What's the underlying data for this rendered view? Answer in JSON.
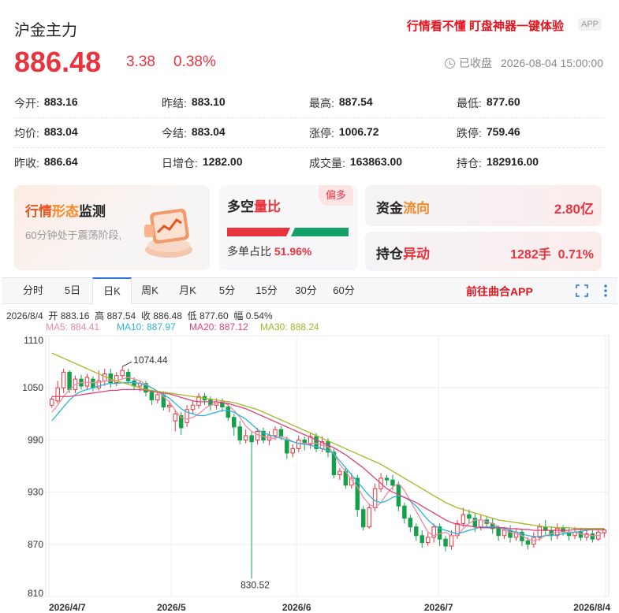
{
  "header": {
    "title": "沪金主力",
    "promo": "行情看不懂 盯盘神器一键体验",
    "app_tag": "APP",
    "price": "886.48",
    "change": "3.38",
    "change_pct": "0.38%",
    "status": "已收盘",
    "datetime": "2026-08-04 15:00:00"
  },
  "stats": [
    [
      {
        "label": "今开:",
        "value": "883.16",
        "color": "red"
      },
      {
        "label": "昨结:",
        "value": "883.10",
        "color": ""
      },
      {
        "label": "最高:",
        "value": "887.54",
        "color": "red"
      },
      {
        "label": "最低:",
        "value": "877.60",
        "color": "green"
      }
    ],
    [
      {
        "label": "均价:",
        "value": "883.04",
        "color": ""
      },
      {
        "label": "今结:",
        "value": "883.04",
        "color": ""
      },
      {
        "label": "涨停:",
        "value": "1006.72",
        "color": ""
      },
      {
        "label": "跌停:",
        "value": "759.46",
        "color": ""
      }
    ],
    [
      {
        "label": "昨收:",
        "value": "886.64",
        "color": ""
      },
      {
        "label": "日增仓:",
        "value": "1282.00",
        "color": ""
      },
      {
        "label": "成交量:",
        "value": "163863.00",
        "color": ""
      },
      {
        "label": "持仓:",
        "value": "182916.00",
        "color": ""
      }
    ]
  ],
  "cards": {
    "monitor_title_a": "行情",
    "monitor_title_b": "形态",
    "monitor_title_c": "监测",
    "monitor_desc": "60分钟处于震荡阶段,",
    "longshort_title_a": "多空",
    "longshort_title_b": "量比",
    "longshort_badge": "偏多",
    "longshort_ratio_label": "多单占比",
    "longshort_ratio": "51.96%",
    "longshort_fraction": 0.5196,
    "flow_title_a": "资金",
    "flow_title_b": "流向",
    "flow_value": "2.80亿",
    "position_title_a": "持仓",
    "position_title_b": "异动",
    "position_value": "1282手",
    "position_pct": "0.71%"
  },
  "tabs": [
    "分时",
    "5日",
    "日K",
    "周K",
    "月K",
    "5分",
    "15分",
    "30分",
    "60分"
  ],
  "active_tab": "日K",
  "open_app": "前往曲合APP",
  "chart_info": {
    "date": "2026/8/4",
    "open_label": "开",
    "open": "883.16",
    "high_label": "高",
    "high": "887.54",
    "close_label": "收",
    "close": "886.48",
    "low_label": "低",
    "low": "877.60",
    "amp_label": "幅",
    "amp": "0.54%"
  },
  "ma": [
    {
      "label": "MA5:",
      "value": "884.41",
      "color": "#f08aa6"
    },
    {
      "label": "MA10:",
      "value": "887.97",
      "color": "#29b5d6"
    },
    {
      "label": "MA20:",
      "value": "887.12",
      "color": "#e0407a"
    },
    {
      "label": "MA30:",
      "value": "888.24",
      "color": "#a3b82a"
    }
  ],
  "chart_data": {
    "type": "candlestick",
    "ylim": [
      810,
      1110
    ],
    "y_ticks": [
      "1110",
      "1050",
      "990",
      "930",
      "870",
      "810"
    ],
    "x_ticks": [
      "2026/4/7",
      "2026/5",
      "2026/6",
      "2026/7",
      "2026/8/4"
    ],
    "annotations": {
      "high": "1074.44",
      "low": "830.52"
    },
    "candles": [
      [
        1030,
        1037,
        1027,
        1040
      ],
      [
        1035,
        1050,
        1032,
        1058
      ],
      [
        1050,
        1068,
        1044,
        1072
      ],
      [
        1068,
        1048,
        1044,
        1070
      ],
      [
        1048,
        1060,
        1044,
        1064
      ],
      [
        1060,
        1052,
        1048,
        1065
      ],
      [
        1052,
        1062,
        1048,
        1066
      ],
      [
        1060,
        1050,
        1046,
        1063
      ],
      [
        1050,
        1058,
        1047,
        1070
      ],
      [
        1058,
        1066,
        1052,
        1072
      ],
      [
        1066,
        1056,
        1050,
        1072
      ],
      [
        1056,
        1064,
        1052,
        1068
      ],
      [
        1064,
        1070,
        1060,
        1074.44
      ],
      [
        1068,
        1058,
        1054,
        1072
      ],
      [
        1058,
        1052,
        1048,
        1062
      ],
      [
        1052,
        1055,
        1046,
        1058
      ],
      [
        1055,
        1045,
        1040,
        1058
      ],
      [
        1045,
        1036,
        1030,
        1048
      ],
      [
        1036,
        1042,
        1032,
        1045
      ],
      [
        1042,
        1028,
        1024,
        1046
      ],
      [
        1028,
        1030,
        1022,
        1035
      ],
      [
        1012,
        1020,
        1000,
        1025
      ],
      [
        1018,
        1004,
        996,
        1022
      ],
      [
        1010,
        1025,
        1005,
        1030
      ],
      [
        1025,
        1030,
        1020,
        1035
      ],
      [
        1030,
        1040,
        1026,
        1044
      ],
      [
        1040,
        1036,
        1030,
        1044
      ],
      [
        1036,
        1030,
        1024,
        1040
      ],
      [
        1030,
        1034,
        1025,
        1038
      ],
      [
        1034,
        1028,
        1022,
        1038
      ],
      [
        1028,
        1016,
        1012,
        1032
      ],
      [
        1016,
        1005,
        995,
        1020
      ],
      [
        1005,
        990,
        985,
        1012
      ],
      [
        990,
        995,
        986,
        1002
      ],
      [
        995,
        988,
        830.52,
        1000
      ],
      [
        990,
        1000,
        985,
        1004
      ],
      [
        1000,
        990,
        986,
        1004
      ],
      [
        990,
        995,
        984,
        1000
      ],
      [
        995,
        1002,
        990,
        1006
      ],
      [
        1002,
        994,
        990,
        1006
      ],
      [
        990,
        975,
        968,
        994
      ],
      [
        975,
        980,
        970,
        985
      ],
      [
        980,
        990,
        976,
        995
      ],
      [
        990,
        985,
        978,
        994
      ],
      [
        985,
        994,
        980,
        998
      ],
      [
        994,
        980,
        976,
        998
      ],
      [
        980,
        988,
        976,
        994
      ],
      [
        988,
        976,
        970,
        992
      ],
      [
        976,
        950,
        946,
        980
      ],
      [
        950,
        954,
        944,
        958
      ],
      [
        954,
        938,
        934,
        958
      ],
      [
        938,
        946,
        934,
        952
      ],
      [
        946,
        910,
        902,
        950
      ],
      [
        910,
        890,
        886,
        914
      ],
      [
        890,
        912,
        888,
        916
      ],
      [
        912,
        934,
        908,
        940
      ],
      [
        934,
        946,
        930,
        952
      ],
      [
        946,
        944,
        938,
        950
      ],
      [
        944,
        938,
        932,
        950
      ],
      [
        938,
        914,
        908,
        942
      ],
      [
        914,
        900,
        894,
        918
      ],
      [
        900,
        890,
        884,
        904
      ],
      [
        890,
        880,
        874,
        894
      ],
      [
        880,
        872,
        866,
        886
      ],
      [
        872,
        878,
        868,
        884
      ],
      [
        878,
        890,
        872,
        894
      ],
      [
        890,
        876,
        868,
        894
      ],
      [
        876,
        868,
        862,
        880
      ],
      [
        868,
        880,
        864,
        886
      ],
      [
        880,
        894,
        876,
        898
      ],
      [
        894,
        904,
        890,
        912
      ],
      [
        904,
        900,
        894,
        910
      ],
      [
        900,
        890,
        884,
        906
      ],
      [
        890,
        898,
        886,
        904
      ],
      [
        898,
        894,
        890,
        902
      ],
      [
        894,
        888,
        882,
        900
      ],
      [
        888,
        880,
        874,
        892
      ],
      [
        880,
        886,
        876,
        890
      ],
      [
        886,
        878,
        872,
        892
      ],
      [
        878,
        884,
        874,
        888
      ],
      [
        884,
        874,
        868,
        888
      ],
      [
        874,
        870,
        864,
        878
      ],
      [
        870,
        878,
        866,
        884
      ],
      [
        878,
        890,
        874,
        894
      ],
      [
        890,
        886,
        880,
        898
      ],
      [
        886,
        880,
        874,
        890
      ],
      [
        880,
        888,
        876,
        894
      ],
      [
        888,
        884,
        880,
        892
      ],
      [
        884,
        880,
        874,
        888
      ],
      [
        880,
        884,
        876,
        890
      ],
      [
        884,
        878,
        874,
        888
      ],
      [
        878,
        882,
        874,
        886
      ],
      [
        882,
        876,
        872,
        888
      ],
      [
        876,
        884,
        874,
        888
      ],
      [
        883.16,
        886.48,
        877.6,
        887.54
      ]
    ],
    "ma_series": {
      "MA5": [
        1022,
        1030,
        1040,
        1048,
        1054,
        1056,
        1056,
        1056,
        1056,
        1058,
        1058,
        1058,
        1060,
        1062,
        1060,
        1058,
        1054,
        1050,
        1046,
        1040,
        1034,
        1024,
        1016,
        1014,
        1016,
        1020,
        1026,
        1030,
        1032,
        1034,
        1030,
        1024,
        1016,
        1006,
        1000,
        996,
        994,
        992,
        992,
        994,
        992,
        988,
        986,
        986,
        986,
        986,
        984,
        982,
        974,
        962,
        954,
        944,
        936,
        924,
        916,
        912,
        918,
        928,
        936,
        940,
        932,
        920,
        908,
        896,
        884,
        880,
        882,
        884,
        880,
        880,
        888,
        894,
        898,
        898,
        896,
        894,
        890,
        886,
        884,
        882,
        880,
        876,
        874,
        876,
        880,
        882,
        884,
        884,
        884,
        884,
        882,
        881,
        880,
        880,
        884.41
      ],
      "MA10": [
        1012,
        1020,
        1028,
        1036,
        1042,
        1046,
        1048,
        1050,
        1052,
        1054,
        1055,
        1055,
        1056,
        1056,
        1056,
        1055,
        1053,
        1050,
        1046,
        1042,
        1038,
        1032,
        1026,
        1022,
        1020,
        1018,
        1018,
        1020,
        1022,
        1024,
        1024,
        1022,
        1018,
        1014,
        1008,
        1002,
        998,
        996,
        994,
        992,
        990,
        988,
        986,
        985,
        984,
        982,
        980,
        978,
        974,
        966,
        958,
        950,
        942,
        934,
        926,
        920,
        918,
        920,
        924,
        926,
        924,
        920,
        914,
        906,
        898,
        892,
        888,
        886,
        884,
        882,
        884,
        886,
        888,
        890,
        890,
        890,
        890,
        888,
        886,
        884,
        882,
        880,
        879,
        879,
        880,
        880,
        881,
        882,
        883,
        884,
        885,
        886,
        887,
        887.5,
        887.97
      ],
      "MA20": [
        1040,
        1040,
        1040,
        1040,
        1041,
        1042,
        1043,
        1044,
        1045,
        1046,
        1047,
        1047,
        1048,
        1048,
        1048,
        1048,
        1047,
        1046,
        1045,
        1044,
        1043,
        1041,
        1039,
        1037,
        1035,
        1034,
        1034,
        1034,
        1034,
        1033,
        1032,
        1030,
        1028,
        1026,
        1023,
        1020,
        1017,
        1014,
        1011,
        1008,
        1005,
        1002,
        999,
        996,
        993,
        990,
        987,
        984,
        981,
        977,
        973,
        968,
        963,
        958,
        952,
        946,
        940,
        934,
        930,
        927,
        924,
        921,
        918,
        914,
        910,
        906,
        902,
        898,
        895,
        893,
        892,
        891,
        890,
        889,
        889,
        889,
        889,
        889,
        888,
        888,
        887,
        887,
        886,
        886,
        886,
        886,
        886,
        886,
        886,
        887,
        887,
        887,
        887,
        887,
        887.12
      ],
      "MA30": [
        1090,
        1087,
        1084,
        1081,
        1078,
        1075,
        1072,
        1069,
        1066,
        1063,
        1060,
        1058,
        1056,
        1054,
        1052,
        1050,
        1048,
        1047,
        1046,
        1045,
        1044,
        1043,
        1042,
        1041,
        1040,
        1039,
        1038,
        1037,
        1036,
        1035,
        1034,
        1033,
        1031,
        1029,
        1027,
        1025,
        1022,
        1019,
        1016,
        1013,
        1010,
        1007,
        1004,
        1001,
        998,
        995,
        992,
        989,
        986,
        983,
        980,
        977,
        974,
        971,
        968,
        965,
        962,
        958,
        954,
        950,
        946,
        942,
        938,
        934,
        930,
        926,
        922,
        918,
        915,
        912,
        910,
        908,
        906,
        904,
        902,
        900,
        898,
        897,
        896,
        895,
        894,
        893,
        892,
        891,
        890,
        890,
        889,
        889,
        889,
        888.5,
        888.4,
        888.3,
        888.3,
        888.2,
        888.24
      ]
    }
  }
}
